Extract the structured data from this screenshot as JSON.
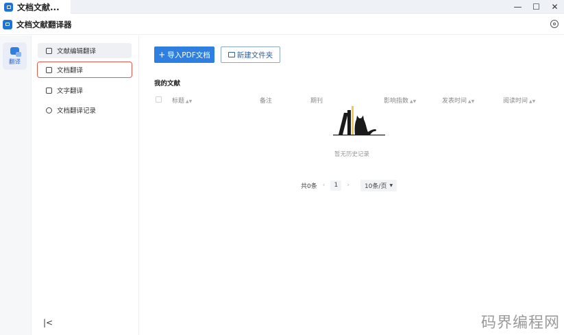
{
  "window": {
    "tab_title": "文档文献...",
    "controls": {
      "minimize": "—",
      "maximize": "☐",
      "close": "✕"
    }
  },
  "header": {
    "title": "文档文献翻译器"
  },
  "rail": {
    "items": [
      {
        "label": "翻译",
        "icon": "translate-icon",
        "active": true
      }
    ]
  },
  "menu": {
    "items": [
      {
        "label": "文献编辑翻译",
        "icon": "lock-icon",
        "active": true
      },
      {
        "label": "文档翻译",
        "icon": "document-icon",
        "highlighted": true
      },
      {
        "label": "文字翻译",
        "icon": "text-icon"
      },
      {
        "label": "文档翻译记录",
        "icon": "clock-icon"
      }
    ],
    "collapse_glyph": "|<"
  },
  "main": {
    "import_button": {
      "icon": "+",
      "label": "导入PDF文档"
    },
    "new_folder_button": {
      "label": "新建文件夹"
    },
    "section_title": "我的文献",
    "columns": [
      "标题",
      "备注",
      "期刊",
      "影响指数",
      "发表时间",
      "阅读时间"
    ],
    "empty_text": "暂无历史记录",
    "pagination": {
      "total": "共0条",
      "prev": "‹",
      "current": "1",
      "next": "›",
      "page_size": "10条/页"
    }
  },
  "watermark": "码界编程网",
  "colors": {
    "primary": "#2f7fe0",
    "highlight_border": "#e05a4f"
  }
}
